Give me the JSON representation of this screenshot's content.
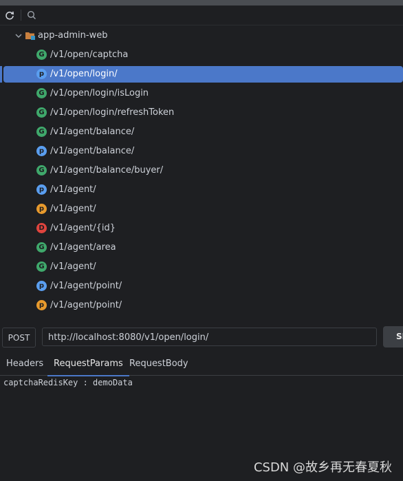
{
  "toolbar": {
    "refresh_icon": "refresh-icon",
    "search_icon": "search-icon"
  },
  "tree": {
    "root": {
      "label": "app-admin-web",
      "expanded": true
    },
    "items": [
      {
        "method": "G",
        "kind": "get",
        "label": "/v1/open/captcha"
      },
      {
        "method": "p",
        "kind": "post",
        "label": "/v1/open/login/",
        "selected": true
      },
      {
        "method": "G",
        "kind": "get",
        "label": "/v1/open/login/isLogin"
      },
      {
        "method": "G",
        "kind": "get",
        "label": "/v1/open/login/refreshToken"
      },
      {
        "method": "G",
        "kind": "get",
        "label": "/v1/agent/balance/"
      },
      {
        "method": "p",
        "kind": "post",
        "label": "/v1/agent/balance/"
      },
      {
        "method": "G",
        "kind": "get",
        "label": "/v1/agent/balance/buyer/"
      },
      {
        "method": "p",
        "kind": "post",
        "label": "/v1/agent/"
      },
      {
        "method": "p",
        "kind": "put",
        "label": "/v1/agent/"
      },
      {
        "method": "D",
        "kind": "delete",
        "label": "/v1/agent/{id}"
      },
      {
        "method": "G",
        "kind": "get",
        "label": "/v1/agent/area"
      },
      {
        "method": "G",
        "kind": "get",
        "label": "/v1/agent/"
      },
      {
        "method": "p",
        "kind": "post",
        "label": "/v1/agent/point/"
      },
      {
        "method": "p",
        "kind": "put",
        "label": "/v1/agent/point/"
      }
    ]
  },
  "request": {
    "method": "POST",
    "url": "http://localhost:8080/v1/open/login/",
    "send_label": "SE"
  },
  "tabs": [
    {
      "label": "Headers",
      "active": false
    },
    {
      "label": "RequestParams",
      "active": true
    },
    {
      "label": "RequestBody",
      "active": false
    }
  ],
  "params_content": "captchaRedisKey : demoData",
  "watermark": "CSDN @故乡再无春夏秋",
  "colors": {
    "selection": "#4b78c9",
    "get": "#3fa86b",
    "post": "#5a9ef0",
    "put": "#e89a2d",
    "delete": "#e0443e"
  }
}
